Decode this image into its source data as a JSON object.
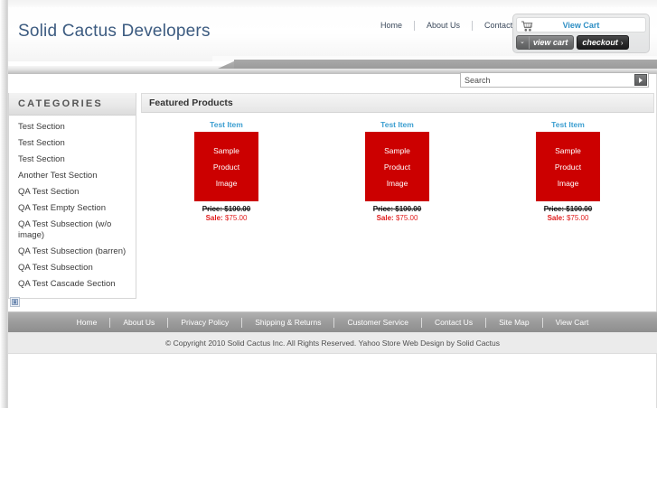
{
  "site": {
    "logo_text": "Solid Cactus Developers"
  },
  "topnav": {
    "items": [
      {
        "label": "Home"
      },
      {
        "label": "About Us"
      },
      {
        "label": "Contact Us"
      }
    ]
  },
  "cart": {
    "icon": "shopping-cart-icon",
    "view_cart_link": "View Cart",
    "view_cart_button": "view cart",
    "checkout_button": "checkout",
    "checkout_arrow": "›",
    "dropdown_chevron": "⌄",
    "accent_color": "#2f8fc4"
  },
  "search": {
    "value": "Search",
    "placeholder": "Search",
    "submit_icon": "play-triangle-icon"
  },
  "sidebar": {
    "title": "CATEGORIES",
    "items": [
      {
        "label": "Test Section"
      },
      {
        "label": "Test Section"
      },
      {
        "label": "Test Section"
      },
      {
        "label": "Another Test Section"
      },
      {
        "label": "QA Test Section"
      },
      {
        "label": "QA Test Empty Section"
      },
      {
        "label": "QA Test Subsection (w/o image)"
      },
      {
        "label": "QA Test Subsection (barren)"
      },
      {
        "label": "QA Test Subsection"
      },
      {
        "label": "QA Test Cascade Section"
      }
    ],
    "broken_image_glyph": "⍰"
  },
  "main": {
    "section_title": "Featured Products",
    "products": [
      {
        "title": "Test Item",
        "image_lines": [
          "Sample",
          "Product",
          "Image"
        ],
        "image_color": "#cc0000",
        "price_label": "Price:",
        "price_value": "$100.00",
        "sale_label": "Sale:",
        "sale_value": "$75.00"
      },
      {
        "title": "Test Item",
        "image_lines": [
          "Sample",
          "Product",
          "Image"
        ],
        "image_color": "#cc0000",
        "price_label": "Price:",
        "price_value": "$100.00",
        "sale_label": "Sale:",
        "sale_value": "$75.00"
      },
      {
        "title": "Test Item",
        "image_lines": [
          "Sample",
          "Product",
          "Image"
        ],
        "image_color": "#cc0000",
        "price_label": "Price:",
        "price_value": "$100.00",
        "sale_label": "Sale:",
        "sale_value": "$75.00"
      }
    ]
  },
  "footer": {
    "links": [
      {
        "label": "Home"
      },
      {
        "label": "About Us"
      },
      {
        "label": "Privacy Policy"
      },
      {
        "label": "Shipping & Returns"
      },
      {
        "label": "Customer Service"
      },
      {
        "label": "Contact Us"
      },
      {
        "label": "Site Map"
      },
      {
        "label": "View Cart"
      }
    ],
    "copyright": "© Copyright 2010 Solid Cactus Inc. All Rights Reserved. Yahoo Store Web Design by Solid Cactus"
  }
}
